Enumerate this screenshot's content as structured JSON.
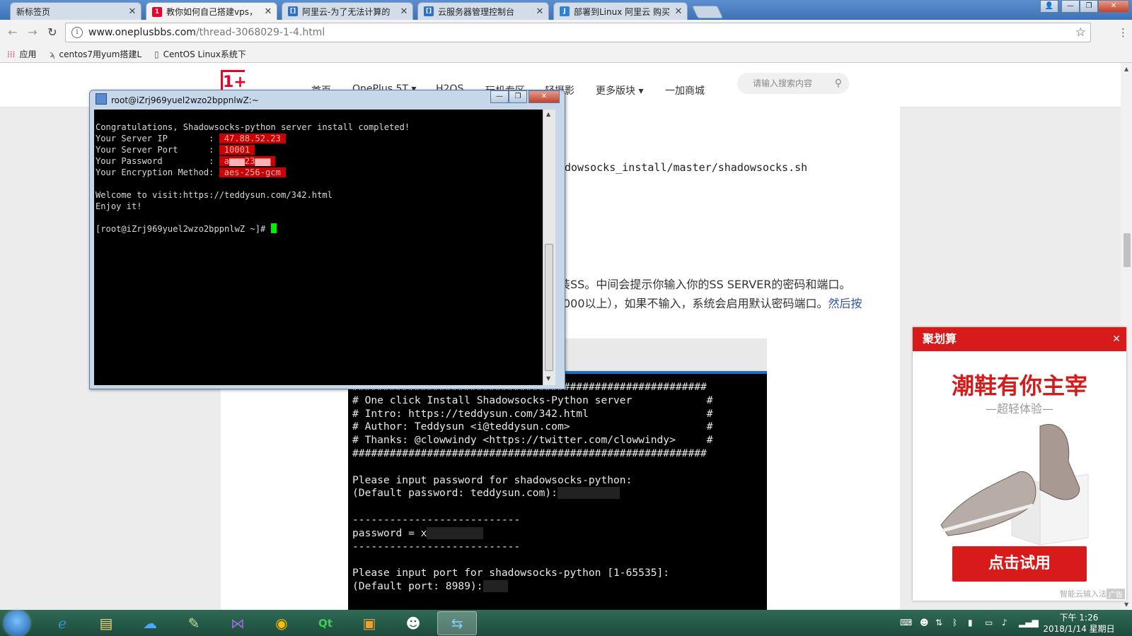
{
  "browser": {
    "tabs": [
      {
        "title": "新标签页",
        "icon": "new-tab-icon",
        "color": "#cccccc"
      },
      {
        "title": "教你如何自己搭建vps，",
        "icon": "oneplus-favicon",
        "color": "#eb0029"
      },
      {
        "title": "阿里云-为了无法计算的",
        "icon": "aliyun-favicon",
        "color": "#2a6fd1"
      },
      {
        "title": "云服务器管理控制台",
        "icon": "aliyun-favicon",
        "color": "#2a6fd1"
      },
      {
        "title": "部署到Linux 阿里云 购买",
        "icon": "j-favicon",
        "color": "#2a83d8"
      }
    ],
    "url_host": "www.oneplusbbs.com",
    "url_path": "/thread-3068029-1-4.html",
    "bookmarks": [
      {
        "label": "应用",
        "icon": "apps-grid-icon"
      },
      {
        "label": "centos7用yum搭建L",
        "icon": "bookmark-page-icon"
      },
      {
        "label": "CentOS Linux系统下",
        "icon": "document-icon"
      }
    ]
  },
  "site": {
    "logo": "1+",
    "nav": [
      "首页",
      "OnePlus 5T ▾",
      "H2OS",
      "玩机专区",
      "轻摄影",
      "更多版块 ▾",
      "一加商城"
    ],
    "search_placeholder": "请输入搜索内容"
  },
  "article": {
    "cmd_fragment": "dowsocks_install/master/shadowsocks.sh",
    "line1": "装SS。中间会提示你输入你的SS SERVER的密码和端口。",
    "line2a": "000以上），如果不输入，系统会启用默认密码端口。",
    "line2b": "然后按",
    "terminal_lines": [
      "#########################################################",
      "# One click Install Shadowsocks-Python server            #",
      "# Intro: https://teddysun.com/342.html                   #",
      "# Author: Teddysun <i@teddysun.com>                      #",
      "# Thanks: @clowwindy <https://twitter.com/clowwindy>     #",
      "#########################################################",
      "",
      "Please input password for shadowsocks-python:",
      "(Default password: teddysun.com):",
      "",
      "---------------------------",
      "password = x",
      "---------------------------",
      "",
      "Please input port for shadowsocks-python [1-65535]:",
      "(Default port: 8989):"
    ]
  },
  "ad": {
    "header": "聚划算",
    "title": "潮鞋有你主宰",
    "subtitle": "—超轻体验—",
    "cta": "点击试用",
    "ime_label": "智能云输入法",
    "tag": "广告"
  },
  "putty": {
    "title": "root@iZrj969yuel2wzo2bppnlwZ:~",
    "line_done": "Congratulations, Shadowsocks-python server install completed!",
    "ip_label": "Your Server IP        : ",
    "ip": "47.88.52.23",
    "port_label": "Your Server Port      : ",
    "port": "10001",
    "pwd_label": "Your Password         : ",
    "pwd": "a▆▆▆23▆▆▆",
    "enc_label": "Your Encryption Method: ",
    "enc": "aes-256-gcm",
    "welcome": "Welcome to visit:https://teddysun.com/342.html",
    "enjoy": "Enjoy it!",
    "prompt": "[root@iZrj969yuel2wzo2bppnlwZ ~]# "
  },
  "taskbar": {
    "apps": [
      "start-orb",
      "ie-icon",
      "explorer-icon",
      "baidu-cloud-icon",
      "notepad-icon",
      "visual-studio-icon",
      "chrome-icon",
      "qt-icon",
      "outlook-icon",
      "qq-icon",
      "putty-icon"
    ],
    "time": "下午 1:26",
    "date": "2018/1/14 星期日"
  }
}
